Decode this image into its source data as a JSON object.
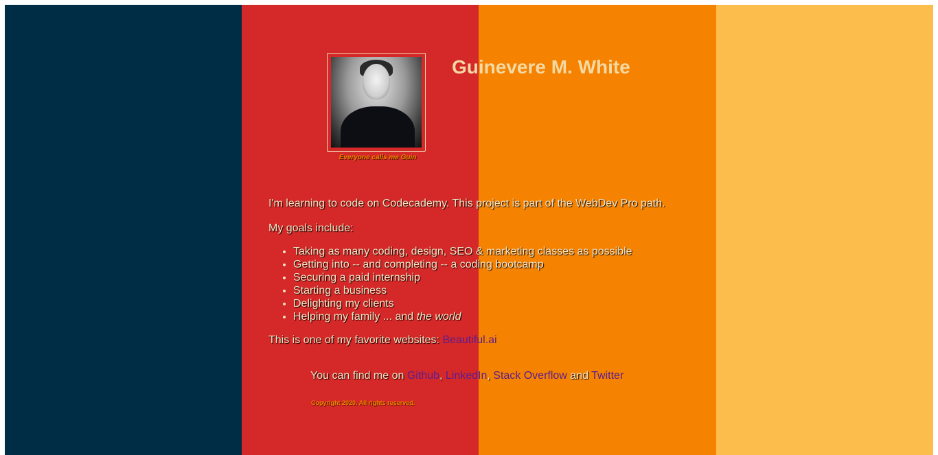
{
  "profile": {
    "name": "Guinevere M. White",
    "photo_caption": "Everyone calls me Guin"
  },
  "intro": "I'm learning to code on Codecademy. This project is part of the WebDev Pro path.",
  "goals": {
    "label": "My goals include:",
    "items": [
      "Taking as many coding, design, SEO & marketing classes as possible",
      "Getting into -- and completing -- a coding bootcamp",
      "Securing a paid internship",
      "Starting a business",
      "Delighting my clients"
    ],
    "last_item_prefix": "Helping my family ... and ",
    "last_item_emphasis": "the world"
  },
  "favorite": {
    "text": "This is one of my favorite websites: ",
    "link": "Beautiful.ai"
  },
  "find_me": {
    "prefix": "You can find me on ",
    "link_github": "Github",
    "sep1": ", ",
    "link_linkedin": "LinkedIn",
    "sep2": ", ",
    "link_stackoverflow": "Stack Overflow",
    "conj": " and ",
    "link_twitter": "Twitter"
  },
  "copyright": "Copyright 2020. All rights reserved.",
  "colors": {
    "stripe_navy": "#002d46",
    "stripe_red": "#d52828",
    "stripe_orange": "#f58200",
    "stripe_yellow": "#fdbd4c",
    "link": "#5c1d8e"
  }
}
